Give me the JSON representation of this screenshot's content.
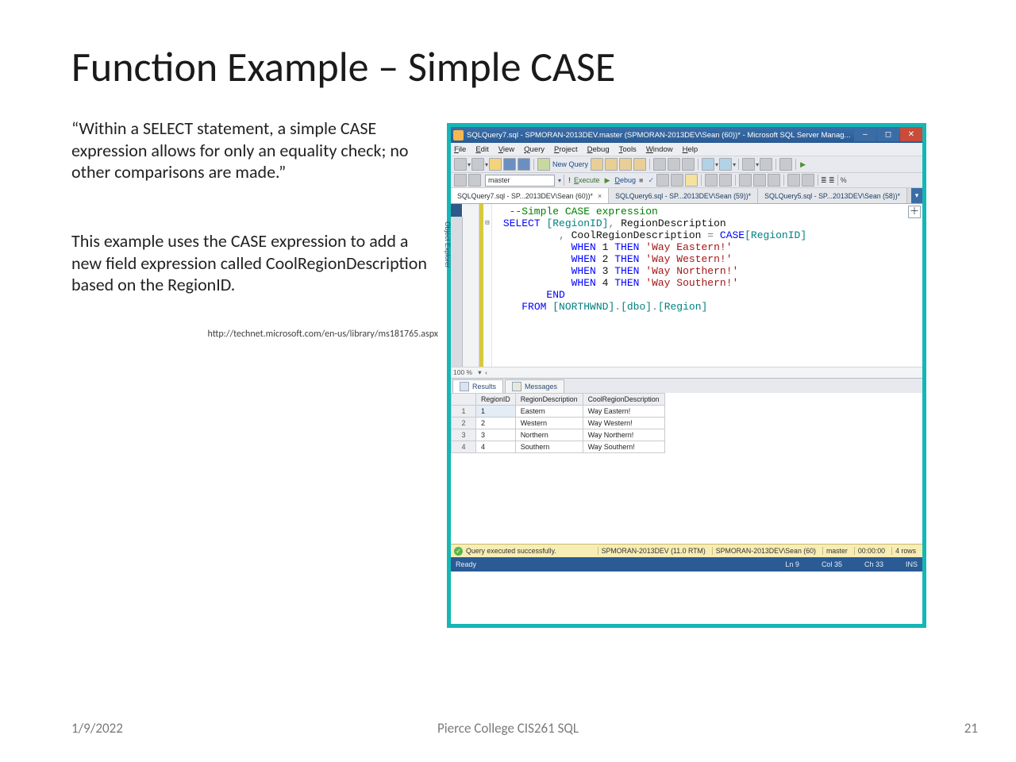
{
  "title": "Function Example – Simple CASE",
  "quote": "“Within a SELECT statement, a simple CASE expression allows for only an equality check; no other comparisons are made.”",
  "description": "This example uses the CASE expression to add a new field expression called CoolRegionDescription based on the RegionID.",
  "citation": "http://technet.microsoft.com/en-us/library/ms181765.aspx",
  "footer": {
    "date": "1/9/2022",
    "center": "Pierce College CIS261 SQL",
    "page": "21"
  },
  "ssms": {
    "titlebar": "SQLQuery7.sql - SPMORAN-2013DEV.master (SPMORAN-2013DEV\\Sean (60))* - Microsoft SQL Server Manag...",
    "menu": [
      "File",
      "Edit",
      "View",
      "Query",
      "Project",
      "Debug",
      "Tools",
      "Window",
      "Help"
    ],
    "newquery_label": "New Query",
    "db_selected": "master",
    "execute_label": "Execute",
    "debug_label": "Debug",
    "sidebar_label": "Object Explorer",
    "tabs": [
      {
        "label": "SQLQuery7.sql - SP...2013DEV\\Sean (60))*",
        "active": true
      },
      {
        "label": "SQLQuery6.sql - SP...2013DEV\\Sean (59))*",
        "active": false
      },
      {
        "label": "SQLQuery5.sql - SP...2013DEV\\Sean (58))*",
        "active": false
      }
    ],
    "sql_lines": [
      {
        "t": "comment",
        "text": "  --Simple CASE expression"
      },
      {
        "t": "sel",
        "text": "SELECT [RegionID], RegionDescription"
      },
      {
        "t": "plain",
        "text": "          , CoolRegionDescription = CASE[RegionID]"
      },
      {
        "t": "when",
        "text": "            WHEN 1 THEN 'Way Eastern!'"
      },
      {
        "t": "when",
        "text": "            WHEN 2 THEN 'Way Western!'"
      },
      {
        "t": "when",
        "text": "            WHEN 3 THEN 'Way Northern!'"
      },
      {
        "t": "when",
        "text": "            WHEN 4 THEN 'Way Southern!'"
      },
      {
        "t": "end",
        "text": "        END"
      },
      {
        "t": "from",
        "text": "    FROM [NORTHWND].[dbo].[Region]"
      }
    ],
    "zoom": "100 %",
    "result_tabs": {
      "results": "Results",
      "messages": "Messages"
    },
    "grid": {
      "headers": [
        "",
        "RegionID",
        "RegionDescription",
        "CoolRegionDescription"
      ],
      "rows": [
        [
          "1",
          "1",
          "Eastern",
          "Way Eastern!"
        ],
        [
          "2",
          "2",
          "Western",
          "Way Western!"
        ],
        [
          "3",
          "3",
          "Northern",
          "Way Northern!"
        ],
        [
          "4",
          "4",
          "Southern",
          "Way Southern!"
        ]
      ]
    },
    "status_yellow": {
      "left": "Query executed successfully.",
      "right": [
        "SPMORAN-2013DEV (11.0 RTM)",
        "SPMORAN-2013DEV\\Sean (60)",
        "master",
        "00:00:00",
        "4 rows"
      ]
    },
    "status_blue": {
      "left": "Ready",
      "ln": "Ln 9",
      "col": "Col 35",
      "ch": "Ch 33",
      "ins": "INS"
    }
  }
}
